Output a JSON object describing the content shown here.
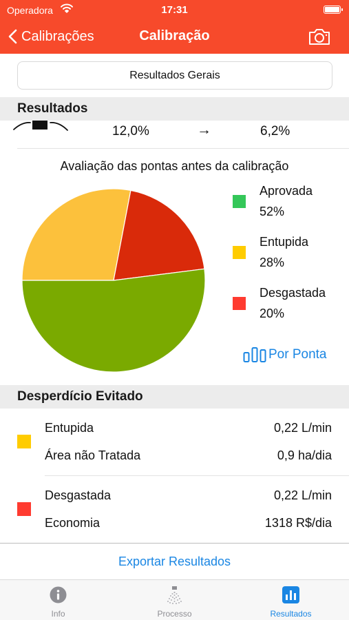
{
  "status_bar": {
    "carrier": "Operadora",
    "time": "17:31"
  },
  "nav": {
    "back_label": "Calibrações",
    "title": "Calibração"
  },
  "segment": {
    "label": "Resultados Gerais"
  },
  "results": {
    "header": "Resultados",
    "partial_row": {
      "before": "12,0%",
      "arrow": "→",
      "after": "6,2%"
    }
  },
  "chart": {
    "title": "Avaliação das pontas antes da calibração",
    "legend": [
      {
        "name": "Aprovada",
        "pct": "52%",
        "color": "#34c759"
      },
      {
        "name": "Entupida",
        "pct": "28%",
        "color": "#ffcc00"
      },
      {
        "name": "Desgastada",
        "pct": "20%",
        "color": "#ff3b30"
      }
    ],
    "link_label": "Por Ponta"
  },
  "chart_data": {
    "type": "pie",
    "title": "Avaliação das pontas antes da calibração",
    "categories": [
      "Aprovada",
      "Entupida",
      "Desgastada"
    ],
    "values": [
      52,
      28,
      20
    ],
    "slice_colors": [
      "#7aaa00",
      "#fcc13c",
      "#d92a0a"
    ],
    "legend_colors": [
      "#34c759",
      "#ffcc00",
      "#ff3b30"
    ],
    "legend": "right"
  },
  "waste": {
    "header": "Desperdício Evitado",
    "groups": [
      {
        "color": "#ffcc00",
        "rows": [
          {
            "label": "Entupida",
            "value": "0,22 L/min"
          },
          {
            "label": "Área não Tratada",
            "value": "0,9 ha/dia"
          }
        ]
      },
      {
        "color": "#ff3b30",
        "rows": [
          {
            "label": "Desgastada",
            "value": "0,22 L/min"
          },
          {
            "label": "Economia",
            "value": "1318 R$/dia"
          }
        ]
      }
    ]
  },
  "export": {
    "label": "Exportar Resultados"
  },
  "tabs": [
    {
      "label": "Info",
      "icon": "info-icon"
    },
    {
      "label": "Processo",
      "icon": "sprayer-icon"
    },
    {
      "label": "Resultados",
      "icon": "bar-chart-icon",
      "selected": true
    }
  ],
  "colors": {
    "accent": "#f74a2b",
    "link": "#1a86e3",
    "tab_inactive": "#8e8e93"
  }
}
